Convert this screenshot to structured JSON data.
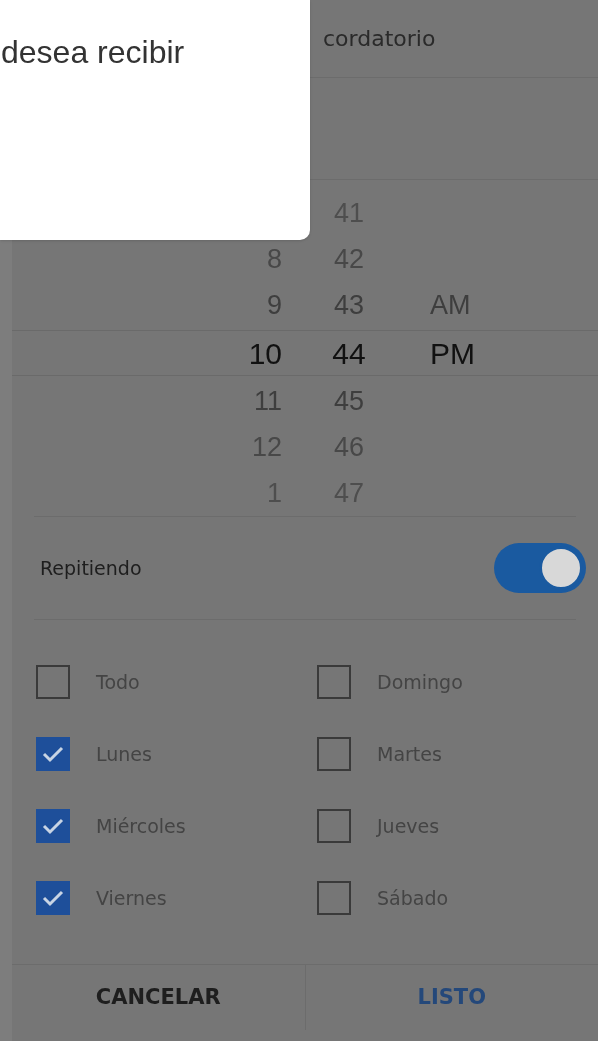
{
  "tooltip": {
    "text": "desea recibir"
  },
  "header": {
    "title": "cordatorio"
  },
  "time_picker": {
    "hours": [
      {
        "label": "8",
        "selected": false
      },
      {
        "label": "9",
        "selected": false
      },
      {
        "label": "10",
        "selected": true
      },
      {
        "label": "11",
        "selected": false
      },
      {
        "label": "12",
        "selected": false
      },
      {
        "label": "1",
        "selected": false
      }
    ],
    "minutes": [
      {
        "label": "41",
        "selected": false
      },
      {
        "label": "42",
        "selected": false
      },
      {
        "label": "43",
        "selected": false
      },
      {
        "label": "44",
        "selected": true
      },
      {
        "label": "45",
        "selected": false
      },
      {
        "label": "46",
        "selected": false
      },
      {
        "label": "47",
        "selected": false
      }
    ],
    "periods": [
      {
        "label": "AM",
        "selected": false
      },
      {
        "label": "PM",
        "selected": true
      }
    ]
  },
  "repeat": {
    "label": "Repitiendo",
    "on": true
  },
  "days": [
    {
      "label": "Todo",
      "checked": false
    },
    {
      "label": "Domingo",
      "checked": false
    },
    {
      "label": "Lunes",
      "checked": true
    },
    {
      "label": "Martes",
      "checked": false
    },
    {
      "label": "Miércoles",
      "checked": true
    },
    {
      "label": "Jueves",
      "checked": false
    },
    {
      "label": "Viernes",
      "checked": true
    },
    {
      "label": "Sábado",
      "checked": false
    }
  ],
  "buttons": [
    {
      "label": "CANCELAR",
      "kind": "cancel"
    },
    {
      "label": "LISTO",
      "kind": "confirm"
    }
  ]
}
